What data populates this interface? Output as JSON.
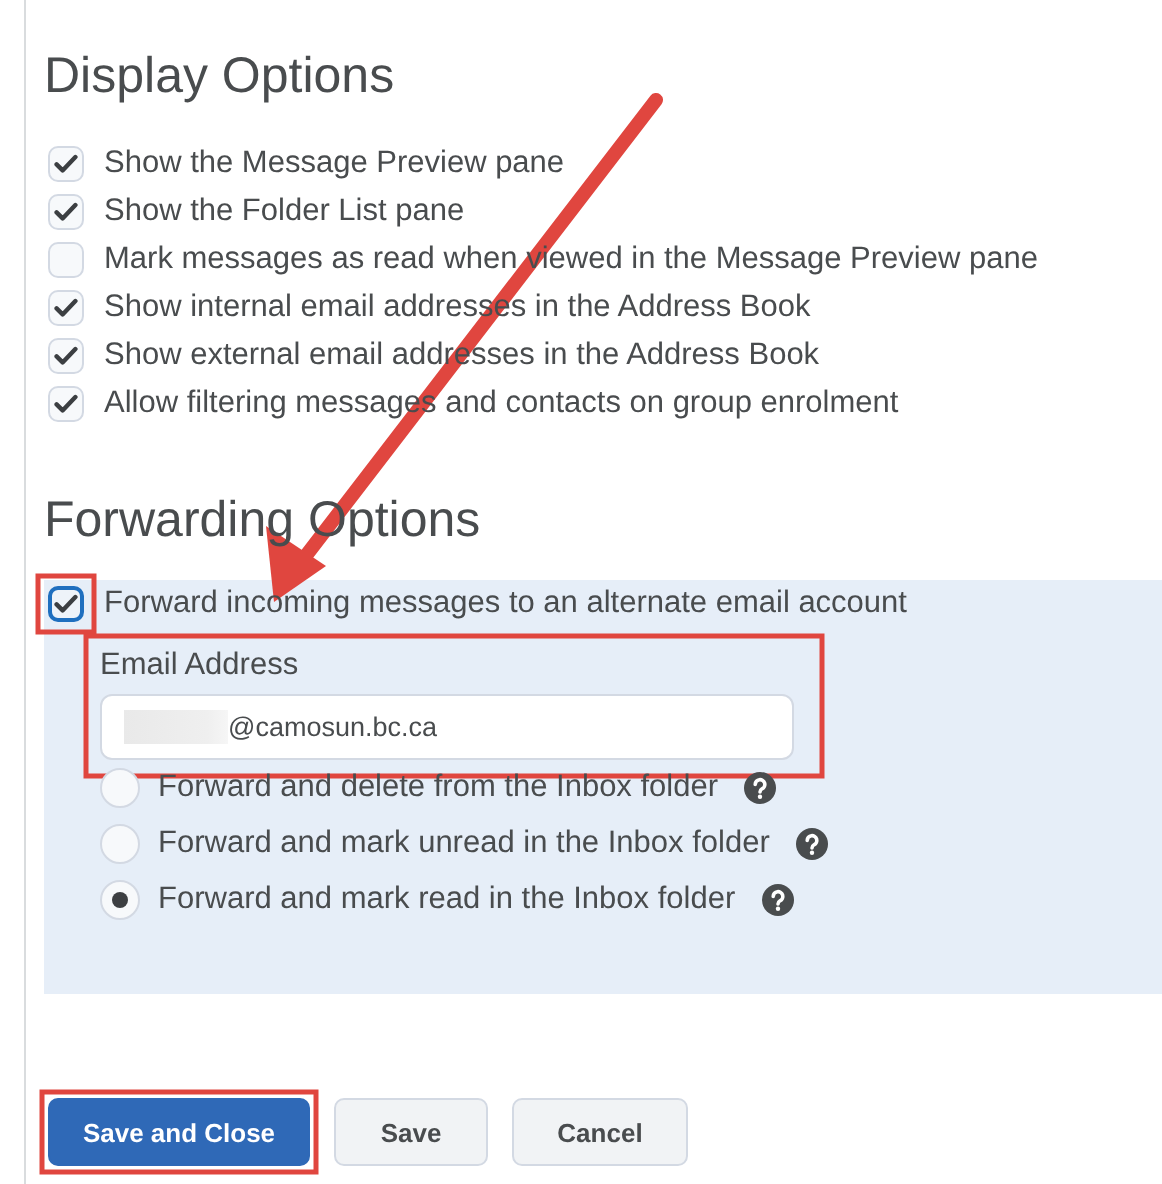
{
  "display_options": {
    "heading": "Display Options",
    "items": [
      {
        "label": "Show the Message Preview pane",
        "checked": true
      },
      {
        "label": "Show the Folder List pane",
        "checked": true
      },
      {
        "label": "Mark messages as read when viewed in the Message Preview pane",
        "checked": false
      },
      {
        "label": "Show internal email addresses in the Address Book",
        "checked": true
      },
      {
        "label": "Show external email addresses in the Address Book",
        "checked": true
      },
      {
        "label": "Allow filtering messages and contacts on group enrolment",
        "checked": true
      }
    ]
  },
  "forwarding_options": {
    "heading": "Forwarding Options",
    "forward": {
      "label": "Forward incoming messages to an alternate email account",
      "checked": true,
      "highlighted": true
    },
    "email": {
      "label": "Email Address",
      "value": "@camosun.bc.ca",
      "redacted": true,
      "highlighted": true,
      "arrow": true
    },
    "modes": [
      {
        "label": "Forward and delete from the Inbox folder",
        "selected": false
      },
      {
        "label": "Forward and mark unread in the Inbox folder",
        "selected": false
      },
      {
        "label": "Forward and mark read in the Inbox folder",
        "selected": true
      }
    ]
  },
  "buttons": [
    {
      "label": "Save and Close",
      "kind": "primary",
      "highlighted": true
    },
    {
      "label": "Save",
      "kind": "secondary",
      "highlighted": false
    },
    {
      "label": "Cancel",
      "kind": "secondary",
      "highlighted": false
    }
  ]
}
